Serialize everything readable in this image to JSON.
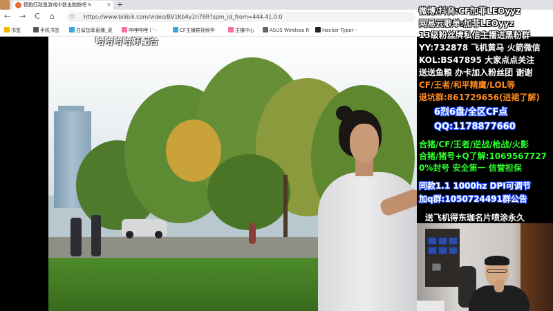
{
  "browser": {
    "tab_title": "德鲍匹敌鱼游戏中数出鲍鲍吧 S",
    "tab_close": "×",
    "new_tab": "+",
    "nav": {
      "back": "←",
      "forward": "→",
      "reload": "C",
      "home": "⌂"
    },
    "url": "https://www.bilibili.com/video/BV1Kb4y1h78R?spm_id_from=444.41.0.0",
    "bookmarks": [
      {
        "label": "书签",
        "color": "#f2b400"
      },
      {
        "label": "手机书签",
        "color": "#555555"
      },
      {
        "label": "白鲨加菲直播_梁",
        "color": "#3aa8e0"
      },
      {
        "label": "哔哩哔哩 ( ' -",
        "color": "#fb7299"
      },
      {
        "label": "CF主播群视频毕",
        "color": "#3aa8e0"
      },
      {
        "label": "主播中心",
        "color": "#fb7299"
      },
      {
        "label": "ASUS Wireless R",
        "color": "#666666"
      },
      {
        "label": "Hacker Typer -",
        "color": "#222222"
      }
    ]
  },
  "video": {
    "subtitle": "哈哈哈哈好配合"
  },
  "overlay": {
    "lines": [
      {
        "text": "微博/抖音:CF加菲LEOyyz",
        "style": "w"
      },
      {
        "text": "网易云歌单:加菲LEOyyz",
        "style": "w"
      },
      {
        "text": "13级粉丝牌私信主播进黑粉群",
        "style": "w"
      },
      {
        "text": "YY:732878 飞机黄马 火箭微信",
        "style": "w"
      },
      {
        "text": "KOL:BS47895 大家点点关注",
        "style": "w"
      },
      {
        "text": "送送鱼粮 办卡加入粉丝团 谢谢",
        "style": "w"
      },
      {
        "text": "CF/王者/和平精鹰/LOL等",
        "style": "o"
      },
      {
        "text": "退坑群:861729656(进裙了解)",
        "style": "o"
      },
      {
        "text": "6烈6盘/全区CF点",
        "style": "b"
      },
      {
        "text": "QQ:1178877660",
        "style": "b"
      },
      {
        "text": "合猪/CF/王者/逆战/枪战/火影",
        "style": "g"
      },
      {
        "text": "合猪/猪号+Q了解:1069567727",
        "style": "g"
      },
      {
        "text": "0%封号 安全第一 信誉担保",
        "style": "g"
      },
      {
        "text": "同款1.1 1000hz DPI可调节",
        "style": "b"
      },
      {
        "text": "加q群:1050724491群公告",
        "style": "b"
      },
      {
        "text": "送飞机得东珈名片喷涂永久",
        "style": "w"
      }
    ]
  }
}
